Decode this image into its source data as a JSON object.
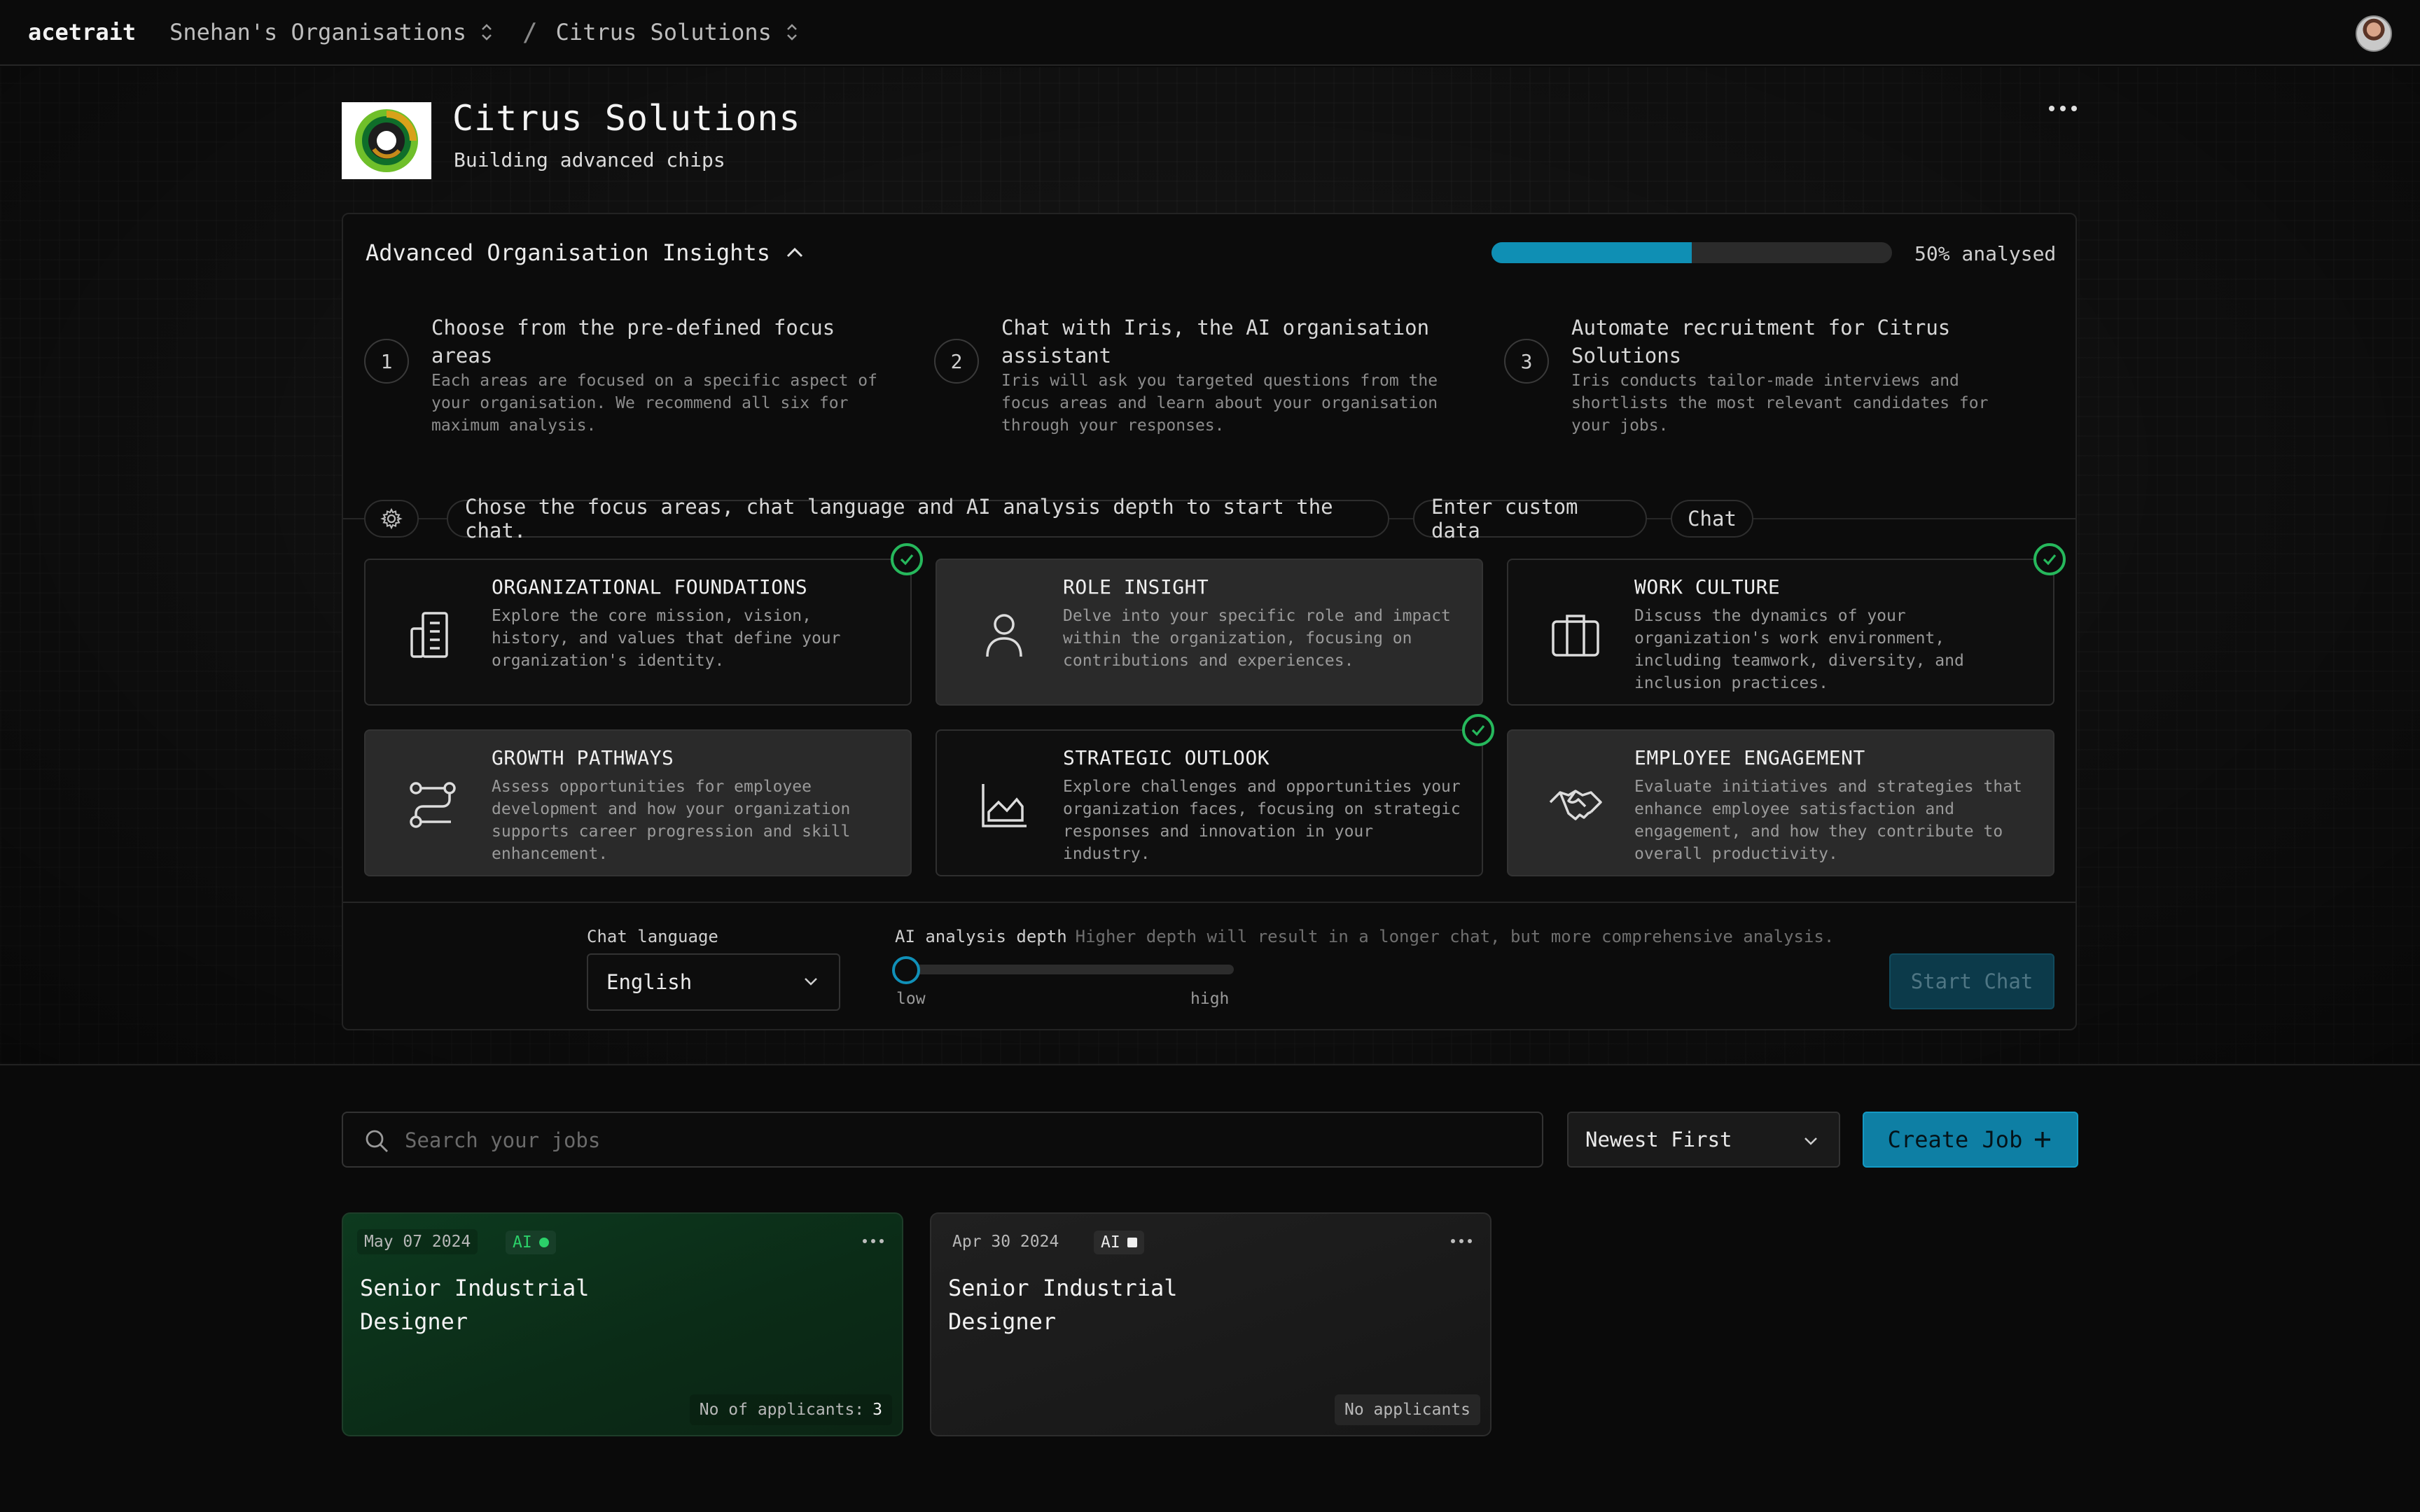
{
  "topbar": {
    "brand": "acetrait",
    "org_switcher": "Snehan's Organisations",
    "separator": "/",
    "company_switcher": "Citrus Solutions"
  },
  "org": {
    "name": "Citrus Solutions",
    "tagline": "Building advanced chips"
  },
  "insights": {
    "title": "Advanced Organisation Insights",
    "progress_percent": 50,
    "progress_label": "50% analysed",
    "steps": [
      {
        "num": "1",
        "title": "Choose from the pre-defined focus areas",
        "desc": "Each areas are focused on a specific aspect of your organisation. We recommend all six for maximum analysis."
      },
      {
        "num": "2",
        "title": "Chat with Iris, the AI organisation assistant",
        "desc": "Iris will ask you targeted questions from the focus areas and learn about your organisation through your responses."
      },
      {
        "num": "3",
        "title": "Automate recruitment for Citrus Solutions",
        "desc": "Iris conducts tailor-made interviews and shortlists the most relevant candidates for your jobs."
      }
    ],
    "toolbar": {
      "hint": "Chose the focus areas, chat language and AI analysis depth to start the chat.",
      "custom_data": "Enter custom data",
      "chat": "Chat"
    },
    "focus_areas": [
      {
        "title": "ORGANIZATIONAL FOUNDATIONS",
        "desc": "Explore the core mission, vision, history, and values that define your organization's identity.",
        "icon": "building-icon",
        "selected": true
      },
      {
        "title": "ROLE INSIGHT",
        "desc": "Delve into your specific role and impact within the organization, focusing on contributions and experiences.",
        "icon": "person-icon",
        "selected": false
      },
      {
        "title": "WORK CULTURE",
        "desc": "Discuss the dynamics of your organization's work environment, including teamwork, diversity, and inclusion practices.",
        "icon": "briefcase-icon",
        "selected": true
      },
      {
        "title": "GROWTH PATHWAYS",
        "desc": "Assess opportunities for employee development and how your organization supports career progression and skill enhancement.",
        "icon": "route-icon",
        "selected": false
      },
      {
        "title": "STRATEGIC OUTLOOK",
        "desc": "Explore challenges and opportunities your organization faces, focusing on strategic responses and innovation in your industry.",
        "icon": "chart-icon",
        "selected": true
      },
      {
        "title": "EMPLOYEE ENGAGEMENT",
        "desc": "Evaluate initiatives and strategies that enhance employee satisfaction and engagement, and how they contribute to overall productivity.",
        "icon": "handshake-icon",
        "selected": false
      }
    ],
    "chat_language": {
      "label": "Chat language",
      "value": "English"
    },
    "depth": {
      "label": "AI analysis depth",
      "note": "Higher depth will result in a longer chat, but more comprehensive analysis.",
      "low": "low",
      "high": "high",
      "value_fraction": 0
    },
    "start_chat": "Start Chat"
  },
  "jobs": {
    "search_placeholder": "Search your jobs",
    "sort_value": "Newest First",
    "create_label": "Create Job",
    "items": [
      {
        "date": "May 07 2024",
        "ai_badge": "AI",
        "title": "Senior Industrial Designer",
        "applicants_label": "No of applicants:",
        "applicants_count": "3"
      },
      {
        "date": "Apr 30 2024",
        "ai_badge": "AI",
        "title": "Senior Industrial Designer",
        "applicants_label": "No applicants",
        "applicants_count": ""
      }
    ]
  },
  "colors": {
    "accent": "#0e7fa4",
    "success": "#26b85c"
  }
}
